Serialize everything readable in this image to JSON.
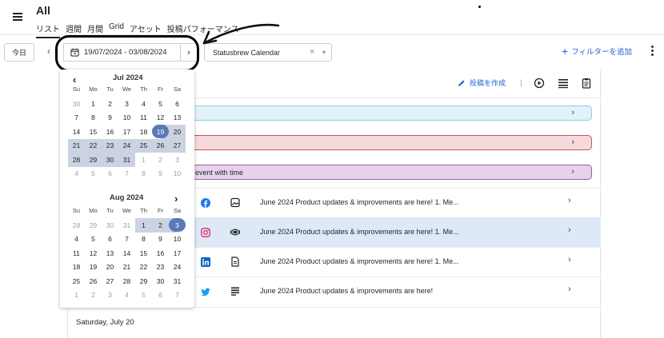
{
  "header": {
    "title": "All",
    "tabs": [
      {
        "label": "リスト",
        "active": true
      },
      {
        "label": "週間",
        "active": false
      },
      {
        "label": "月間",
        "active": false
      },
      {
        "label": "Grid",
        "active": false
      },
      {
        "label": "アセット",
        "active": false
      },
      {
        "label": "投稿パフォーマンス",
        "active": false
      }
    ]
  },
  "toolbar": {
    "today_label": "今日",
    "prev_symbol": "‹",
    "date_range": "19/07/2024 - 03/08/2024",
    "next_symbol": "›",
    "calendar_select_value": "Statusbrew Calendar",
    "clear_symbol": "×",
    "caret_symbol": "▾",
    "add_filter_label": "フィルターを追加",
    "add_filter_plus": "+"
  },
  "main": {
    "create_post_label": "投稿を作成",
    "separator": "|",
    "banners": [
      {
        "color": "#e1f2fb",
        "text": "",
        "chevron": "›"
      },
      {
        "color": "#f6d9dc",
        "text": "",
        "chevron": "›"
      },
      {
        "color": "#e6d3ea",
        "text": "event with time",
        "chevron": "›"
      }
    ],
    "posts": [
      {
        "network": "facebook-icon",
        "type": "image-icon",
        "text": "June 2024 Product updates & improvements are here! 1. Me...",
        "selected": false,
        "chevron": "›"
      },
      {
        "network": "instagram-icon",
        "type": "carousel-icon",
        "text": "June 2024 Product updates & improvements are here! 1. Me...",
        "selected": true,
        "chevron": "›"
      },
      {
        "network": "linkedin-icon",
        "type": "document-icon",
        "text": "June 2024 Product updates & improvements are here! 1. Me...",
        "selected": false,
        "chevron": "›"
      },
      {
        "network": "twitter-icon",
        "type": "text-icon",
        "text": "June 2024 Product updates & improvements are here!",
        "selected": false,
        "chevron": "›"
      }
    ],
    "day_header": "Saturday, July 20"
  },
  "picker": {
    "months": [
      {
        "title": "Jul 2024",
        "nav": "‹",
        "weekdays": [
          "Su",
          "Mo",
          "Tu",
          "We",
          "Th",
          "Fr",
          "Sa"
        ],
        "weeks": [
          [
            "30",
            "1",
            "2",
            "3",
            "4",
            "5",
            "6"
          ],
          [
            "7",
            "8",
            "9",
            "10",
            "11",
            "12",
            "13"
          ],
          [
            "14",
            "15",
            "16",
            "17",
            "18",
            "19",
            "20"
          ],
          [
            "21",
            "22",
            "23",
            "24",
            "25",
            "26",
            "27"
          ],
          [
            "28",
            "29",
            "30",
            "31",
            "1",
            "2",
            "3"
          ],
          [
            "4",
            "5",
            "6",
            "7",
            "8",
            "9",
            "10"
          ]
        ]
      },
      {
        "title": "Aug 2024",
        "nav": "›",
        "weekdays": [
          "Su",
          "Mo",
          "Tu",
          "We",
          "Th",
          "Fr",
          "Sa"
        ],
        "weeks": [
          [
            "28",
            "29",
            "30",
            "31",
            "1",
            "2",
            "3"
          ],
          [
            "4",
            "5",
            "6",
            "7",
            "8",
            "9",
            "10"
          ],
          [
            "11",
            "12",
            "13",
            "14",
            "15",
            "16",
            "17"
          ],
          [
            "18",
            "19",
            "20",
            "21",
            "22",
            "23",
            "24"
          ],
          [
            "25",
            "26",
            "27",
            "28",
            "29",
            "30",
            "31"
          ],
          [
            "1",
            "2",
            "3",
            "4",
            "5",
            "6",
            "7"
          ]
        ]
      }
    ],
    "selection_color": "#5b79b8",
    "range_color": "#cbd3e2"
  }
}
